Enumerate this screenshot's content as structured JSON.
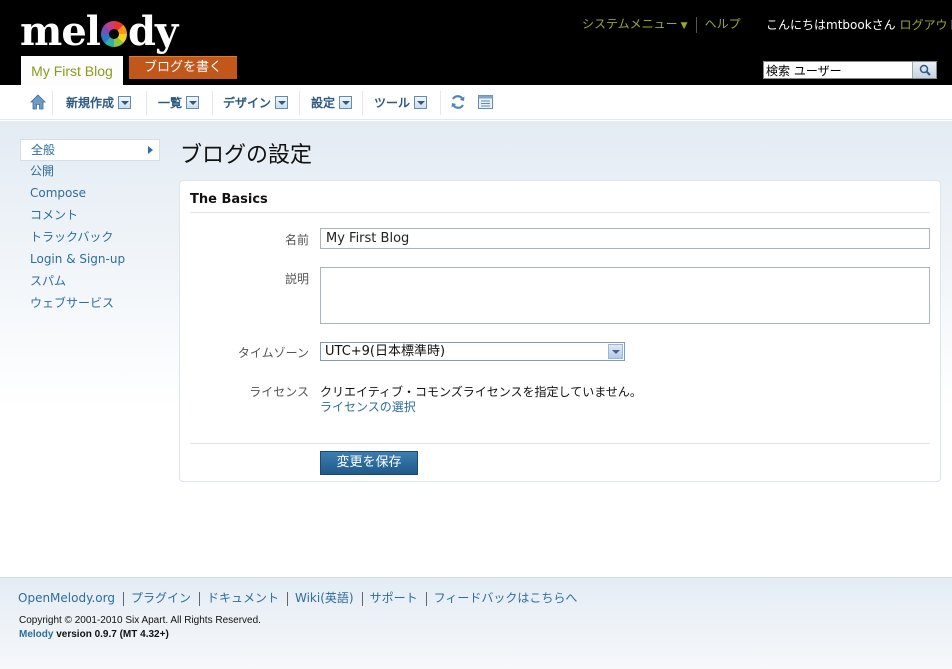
{
  "header": {
    "logo": {
      "pre": "mel",
      "post": "dy"
    },
    "blog_tab": "My First Blog",
    "write_button": "ブログを書く",
    "system_menu": "システムメニュー",
    "help": "ヘルプ",
    "greeting": "こんにちはmtbookさん",
    "logout": "ログアウト",
    "search": {
      "value": "検索 ユーザー"
    }
  },
  "nav": {
    "home_icon": "home-icon",
    "items": [
      {
        "label": "新規作成"
      },
      {
        "label": "一覧"
      },
      {
        "label": "デザイン"
      },
      {
        "label": "設定"
      },
      {
        "label": "ツール"
      }
    ],
    "refresh_icon": "refresh-icon",
    "view_icon": "list-view-icon"
  },
  "sidebar": {
    "items": [
      {
        "label": "全般",
        "active": true
      },
      {
        "label": "公開"
      },
      {
        "label": "Compose"
      },
      {
        "label": "コメント"
      },
      {
        "label": "トラックバック"
      },
      {
        "label": "Login & Sign-up"
      },
      {
        "label": "スパム"
      },
      {
        "label": "ウェブサービス"
      }
    ]
  },
  "main": {
    "title": "ブログの設定",
    "panel_title": "The Basics",
    "fields": {
      "name_label": "名前",
      "name_value": "My First Blog",
      "description_label": "説明",
      "description_value": "",
      "timezone_label": "タイムゾーン",
      "timezone_value": "UTC+9(日本標準時)",
      "license_label": "ライセンス",
      "license_text": "クリエイティブ・コモンズライセンスを指定していません。",
      "license_link": "ライセンスの選択"
    },
    "save_button": "変更を保存"
  },
  "footer": {
    "links": [
      "OpenMelody.org",
      "プラグイン",
      "ドキュメント",
      "Wiki(英語)",
      "サポート",
      "フィードバックはこちらへ"
    ],
    "copyright": "Copyright © 2001-2010 Six Apart. All Rights Reserved.",
    "version_brand": "Melody",
    "version_text": " version 0.9.7 (MT 4.32+)"
  },
  "colors": {
    "header_bg": "#000000",
    "accent_green": "#9aa82a",
    "write_button": "#c1571a",
    "link_blue": "#2c6e9e",
    "save_button": "#1f5a8a"
  }
}
